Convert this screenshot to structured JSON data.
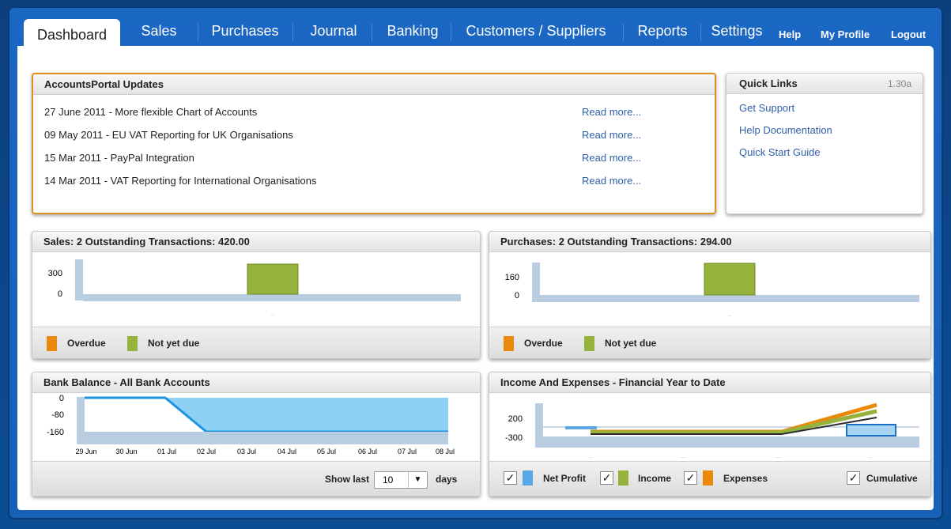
{
  "nav": {
    "tabs": [
      "Dashboard",
      "Sales",
      "Purchases",
      "Journal",
      "Banking",
      "Customers / Suppliers",
      "Reports",
      "Settings"
    ],
    "help": "Help",
    "profile": "My Profile",
    "logout": "Logout"
  },
  "updates": {
    "title": "AccountsPortal Updates",
    "items": [
      {
        "text": "27 June 2011 - More flexible Chart of Accounts",
        "link": "Read more..."
      },
      {
        "text": "09 May 2011 - EU VAT Reporting for UK Organisations",
        "link": "Read more..."
      },
      {
        "text": "15 Mar 2011 - PayPal Integration",
        "link": "Read more..."
      },
      {
        "text": "14 Mar 2011 - VAT Reporting for International Organisations",
        "link": "Read more..."
      }
    ]
  },
  "quick_links": {
    "title": "Quick Links",
    "version": "1.30a",
    "items": [
      "Get Support",
      "Help Documentation",
      "Quick Start Guide"
    ]
  },
  "sales": {
    "title": "Sales: 2 Outstanding Transactions: 420.00",
    "legend": [
      "Overdue",
      "Not yet due"
    ]
  },
  "purchases": {
    "title": "Purchases: 2 Outstanding Transactions: 294.00",
    "legend": [
      "Overdue",
      "Not yet due"
    ]
  },
  "bank": {
    "title": "Bank Balance - All Bank Accounts",
    "show_last": "Show last",
    "days_value": "10",
    "days": "days"
  },
  "income": {
    "title": "Income And Expenses - Financial Year to Date",
    "legend": [
      "Net Profit",
      "Income",
      "Expenses",
      "Cumulative"
    ]
  },
  "colors": {
    "overdue": "#e98a0c",
    "not_yet_due": "#95b33c",
    "bank_fill": "#8fd0f5",
    "bank_line": "#1d93e0",
    "axis": "#b9cde0",
    "net_profit": "#5aa7e6"
  },
  "chart_data": [
    {
      "type": "bar",
      "title": "Sales: 2 Outstanding Transactions: 420.00",
      "categories": [
        ""
      ],
      "series": [
        {
          "name": "Overdue",
          "values": [
            0
          ]
        },
        {
          "name": "Not yet due",
          "values": [
            420
          ]
        }
      ],
      "yticks": [
        300,
        0
      ],
      "ylim": [
        0,
        450
      ]
    },
    {
      "type": "bar",
      "title": "Purchases: 2 Outstanding Transactions: 294.00",
      "categories": [
        ""
      ],
      "series": [
        {
          "name": "Overdue",
          "values": [
            0
          ]
        },
        {
          "name": "Not yet due",
          "values": [
            294
          ]
        }
      ],
      "yticks": [
        160,
        0
      ],
      "ylim": [
        0,
        320
      ]
    },
    {
      "type": "area",
      "title": "Bank Balance - All Bank Accounts",
      "x": [
        "29 Jun",
        "30 Jun",
        "01 Jul",
        "02 Jul",
        "03 Jul",
        "04 Jul",
        "05 Jul",
        "06 Jul",
        "07 Jul",
        "08 Jul"
      ],
      "values": [
        0,
        0,
        0,
        -160,
        -160,
        -160,
        -160,
        -160,
        -160,
        -160
      ],
      "yticks": [
        0,
        -80,
        -160
      ],
      "ylim": [
        -160,
        0
      ]
    },
    {
      "type": "line",
      "title": "Income And Expenses - Financial Year to Date",
      "categories": [
        "",
        "",
        "",
        ""
      ],
      "series": [
        {
          "name": "Net Profit",
          "values": [
            0,
            0,
            0,
            -130
          ]
        },
        {
          "name": "Income",
          "values": [
            -50,
            -50,
            -50,
            550
          ]
        },
        {
          "name": "Expenses",
          "values": [
            -20,
            -20,
            -20,
            750
          ]
        }
      ],
      "yticks": [
        200,
        -300
      ],
      "ylim": [
        -300,
        800
      ]
    }
  ]
}
